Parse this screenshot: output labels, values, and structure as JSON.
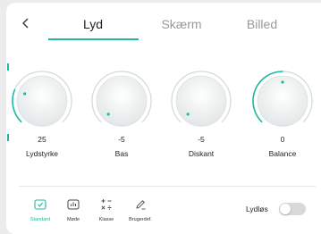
{
  "header": {
    "back_icon": "chevron-left-icon",
    "tabs": [
      {
        "label": "Lyd",
        "active": true
      },
      {
        "label": "Skærm",
        "active": false
      },
      {
        "label": "Billed",
        "active": false
      }
    ]
  },
  "knobs": [
    {
      "value": "25",
      "label": "Lydstyrke",
      "level": 0.25,
      "min": 0,
      "max": 100
    },
    {
      "value": "-5",
      "label": "Bas",
      "level": 0.0,
      "min": -50,
      "max": 50
    },
    {
      "value": "-5",
      "label": "Diskant",
      "level": 0.0,
      "min": -50,
      "max": 50
    },
    {
      "value": "0",
      "label": "Balance",
      "level": 0.5,
      "min": -50,
      "max": 50
    }
  ],
  "modes": [
    {
      "label": "Standard",
      "icon": "check-square-icon",
      "active": true
    },
    {
      "label": "Møde",
      "icon": "equalizer-bars-icon",
      "active": false
    },
    {
      "label": "Klasse",
      "icon": "math-symbols-icon",
      "active": false
    },
    {
      "label": "Brugerdef.",
      "icon": "pencil-icon",
      "active": false
    }
  ],
  "mute": {
    "label": "Lydløs",
    "on": false
  },
  "colors": {
    "accent": "#1fb8a0",
    "ring": "#d4d8d8",
    "inactive_text": "#9a9a9a"
  }
}
